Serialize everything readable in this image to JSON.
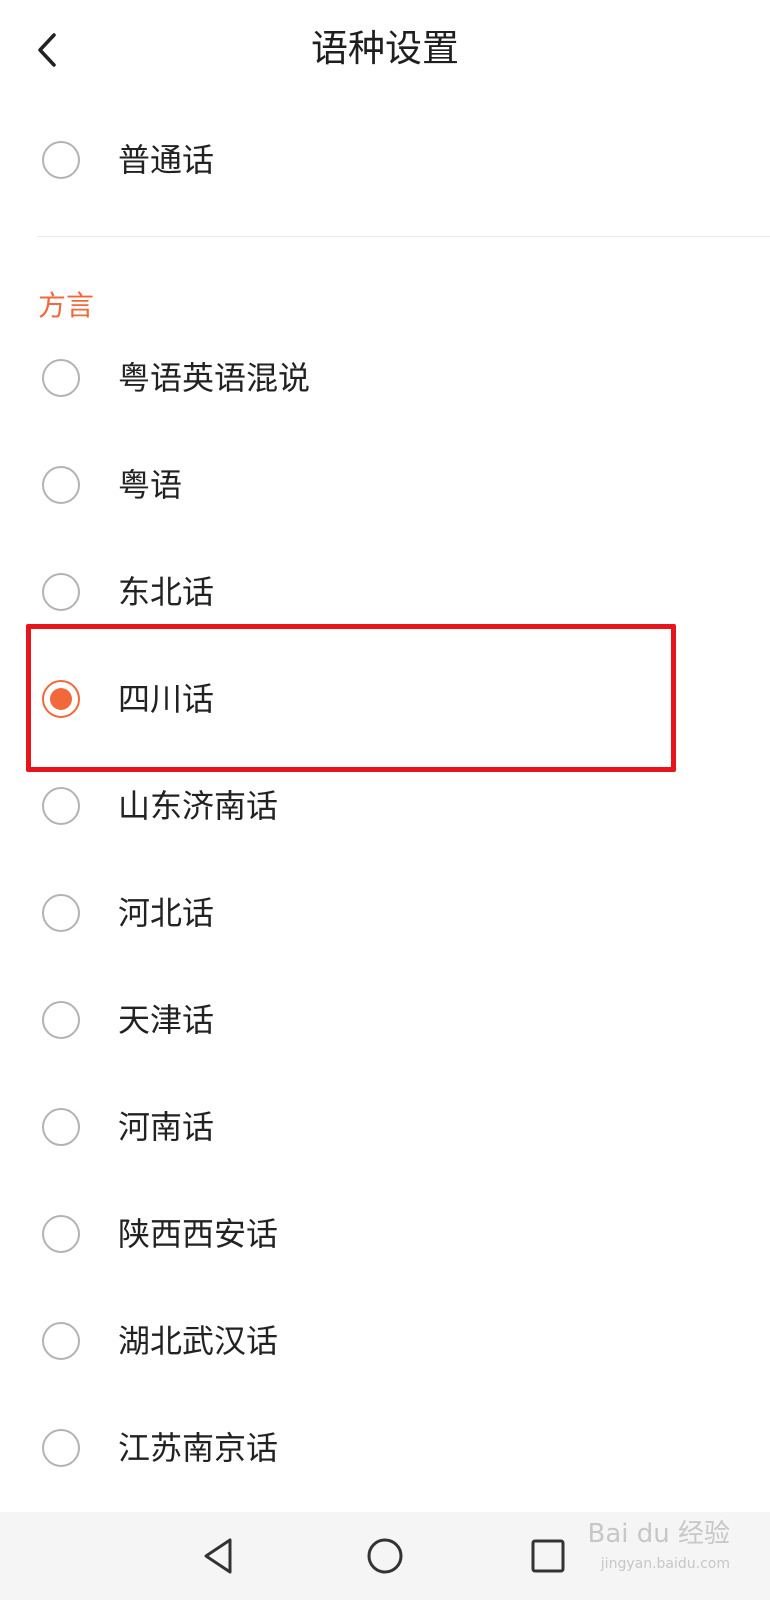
{
  "header": {
    "title": "语种设置",
    "back_icon": "chevron-left-icon"
  },
  "mandarin": {
    "label": "普通话",
    "selected": false
  },
  "dialect_section": {
    "title": "方言",
    "items": [
      {
        "label": "粤语英语混说",
        "selected": false
      },
      {
        "label": "粤语",
        "selected": false
      },
      {
        "label": "东北话",
        "selected": false
      },
      {
        "label": "四川话",
        "selected": true
      },
      {
        "label": "山东济南话",
        "selected": false
      },
      {
        "label": "河北话",
        "selected": false
      },
      {
        "label": "天津话",
        "selected": false
      },
      {
        "label": "河南话",
        "selected": false
      },
      {
        "label": "陕西西安话",
        "selected": false
      },
      {
        "label": "湖北武汉话",
        "selected": false
      },
      {
        "label": "江苏南京话",
        "selected": false
      }
    ]
  },
  "navbar": {
    "back_icon": "triangle-back-icon",
    "home_icon": "circle-home-icon",
    "recents_icon": "square-recents-icon"
  },
  "watermark": {
    "text": "Bai du 经验",
    "sub": "jingyan.baidu.com"
  },
  "colors": {
    "accent": "#f3683a",
    "highlight": "#e8141b",
    "radio_border": "#b3b3b3"
  }
}
